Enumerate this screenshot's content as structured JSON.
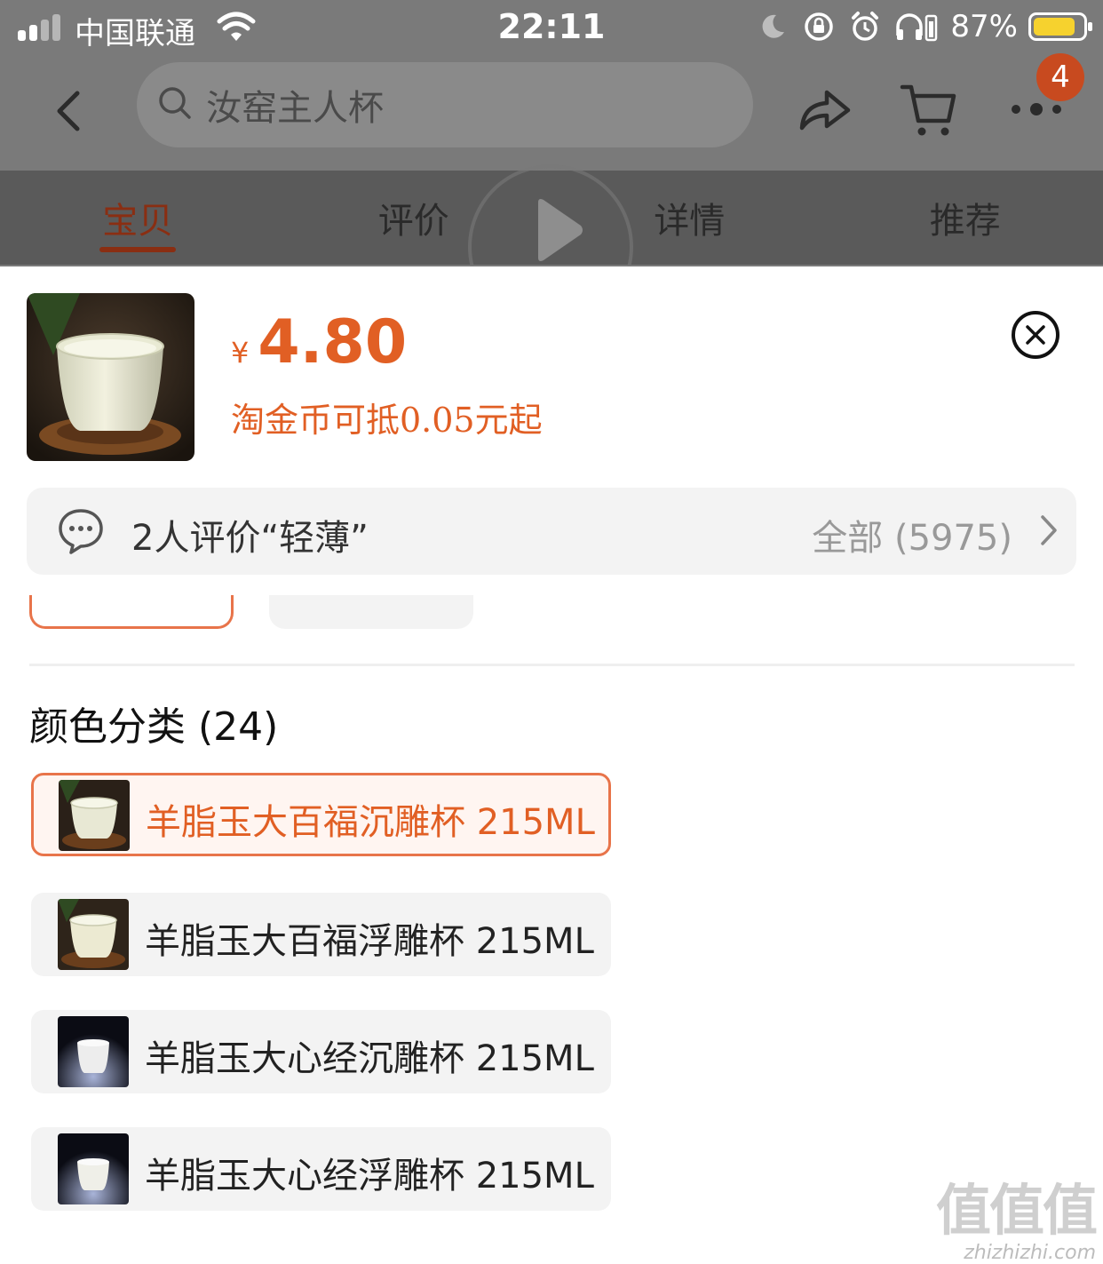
{
  "status_bar": {
    "carrier": "中国联通",
    "time": "22:11",
    "battery": "87%",
    "battery_level": 0.87
  },
  "nav": {
    "search_text": "汝窑主人杯",
    "cart_badge": "4"
  },
  "tabs": [
    {
      "label": "宝贝",
      "active": true
    },
    {
      "label": "评价",
      "active": false
    },
    {
      "label": "详情",
      "active": false
    },
    {
      "label": "推荐",
      "active": false
    }
  ],
  "product": {
    "currency": "¥",
    "price": "4.80",
    "coin_note": "淘金币可抵0.05元起"
  },
  "review": {
    "summary": "2人评价“轻薄”",
    "all_label": "全部 (5975)"
  },
  "section": {
    "title": "颜色分类 (24)"
  },
  "options": [
    {
      "label": "羊脂玉大百福沉雕杯 215ML",
      "selected": true
    },
    {
      "label": "羊脂玉大百福浮雕杯 215ML",
      "selected": false
    },
    {
      "label": "羊脂玉大心经沉雕杯 215ML",
      "selected": false
    },
    {
      "label": "羊脂玉大心经浮雕杯 215ML",
      "selected": false
    }
  ],
  "watermark": {
    "big": "值值值",
    "small": "zhizhizhi.com"
  },
  "colors": {
    "accent": "#e15f24",
    "accent_border": "#e8744a",
    "overlay": "#7a7a7a"
  }
}
